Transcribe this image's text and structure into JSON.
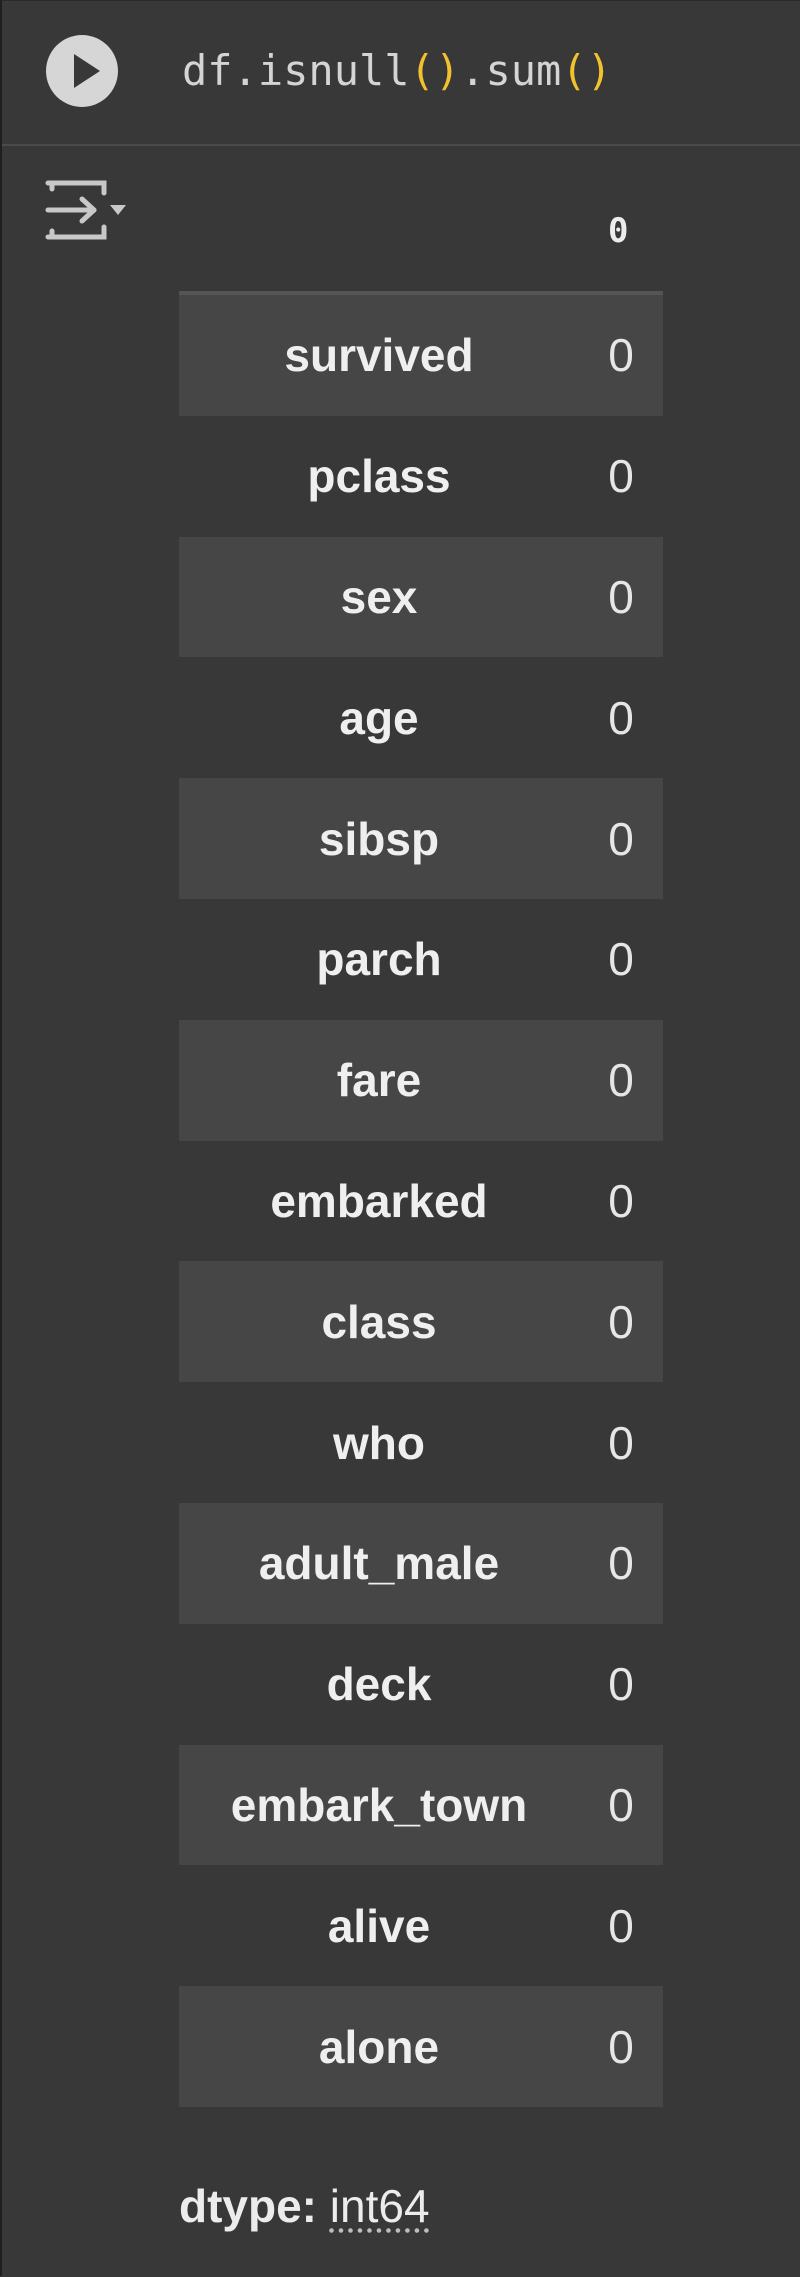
{
  "code_cell": {
    "code_prefix": "df.isnull",
    "paren_1": "()",
    "mid": ".sum",
    "paren_2": "()"
  },
  "output": {
    "column_header": "0",
    "rows": [
      {
        "label": "survived",
        "value": "0"
      },
      {
        "label": "pclass",
        "value": "0"
      },
      {
        "label": "sex",
        "value": "0"
      },
      {
        "label": "age",
        "value": "0"
      },
      {
        "label": "sibsp",
        "value": "0"
      },
      {
        "label": "parch",
        "value": "0"
      },
      {
        "label": "fare",
        "value": "0"
      },
      {
        "label": "embarked",
        "value": "0"
      },
      {
        "label": "class",
        "value": "0"
      },
      {
        "label": "who",
        "value": "0"
      },
      {
        "label": "adult_male",
        "value": "0"
      },
      {
        "label": "deck",
        "value": "0"
      },
      {
        "label": "embark_town",
        "value": "0"
      },
      {
        "label": "alive",
        "value": "0"
      },
      {
        "label": "alone",
        "value": "0"
      }
    ],
    "dtype_label": "dtype:",
    "dtype_value": "int64"
  },
  "icons": {
    "run": "play-icon",
    "output_toggle": "output-collapse-icon"
  },
  "colors": {
    "background": "#383838",
    "row_stripe": "#464646",
    "paren": "#f2c12e"
  }
}
